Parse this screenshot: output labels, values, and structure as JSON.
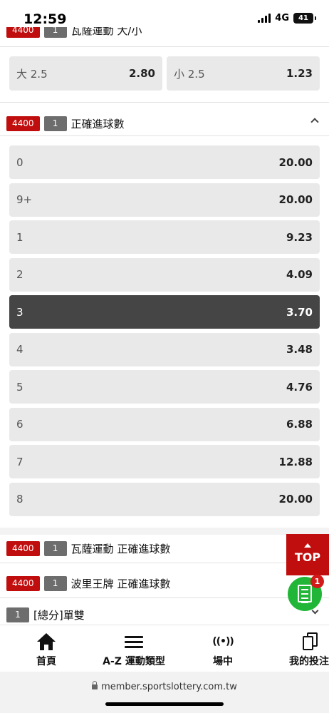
{
  "status_bar": {
    "time": "12:59",
    "network": "4G",
    "battery": "41"
  },
  "clipped_market": {
    "code": "4400",
    "number": "1",
    "title": "瓦薩運動 大/小"
  },
  "over_under": {
    "over_label": "大 2.5",
    "over_odds": "2.80",
    "under_label": "小 2.5",
    "under_odds": "1.23"
  },
  "correct_score_market": {
    "code": "4400",
    "number": "1",
    "title": "正確進球數",
    "rows": [
      {
        "label": "0",
        "odds": "20.00"
      },
      {
        "label": "9+",
        "odds": "20.00"
      },
      {
        "label": "1",
        "odds": "9.23"
      },
      {
        "label": "2",
        "odds": "4.09"
      },
      {
        "label": "3",
        "odds": "3.70",
        "selected": true
      },
      {
        "label": "4",
        "odds": "3.48"
      },
      {
        "label": "5",
        "odds": "4.76"
      },
      {
        "label": "6",
        "odds": "6.88"
      },
      {
        "label": "7",
        "odds": "12.88"
      },
      {
        "label": "8",
        "odds": "20.00"
      }
    ]
  },
  "market_vasa": {
    "code": "4400",
    "number": "1",
    "title": "瓦薩運動 正確進球數"
  },
  "market_boli": {
    "code": "4400",
    "number": "1",
    "title": "波里王牌 正確進球數"
  },
  "market_oddeven": {
    "number": "1",
    "title": "[總分]單雙"
  },
  "top_button": {
    "label": "TOP"
  },
  "betslip": {
    "count": "1"
  },
  "bottom_nav": {
    "home": "首頁",
    "az": "A-Z 運動類型",
    "live_icon": "((•))",
    "live": "場中",
    "mybets": "我的投注"
  },
  "browser": {
    "url": "member.sportslottery.com.tw"
  },
  "colors": {
    "brand_red": "#c00d0d",
    "badge_grey": "#6d6d6d",
    "selected_row": "#454545",
    "betslip_green": "#21b637"
  }
}
